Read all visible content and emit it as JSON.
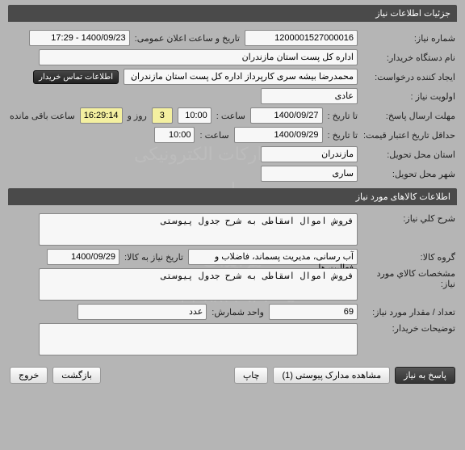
{
  "watermark": {
    "line1": "سامانه تدارکات الکترونیکی دولت",
    "line2": "پایگاه اطلاع رسانی مناقصات و مزایدات",
    "line3": "۰۲۱-۸۸۳۴۹۶۷۰-۵"
  },
  "need": {
    "header": "جزئیات اطلاعات نیاز",
    "number_label": "شماره نیاز:",
    "number": "1200001527000016",
    "announce_label": "تاریخ و ساعت اعلان عمومی:",
    "announce": "1400/09/23 - 17:29",
    "buyer_label": "نام دستگاه خریدار:",
    "buyer": "اداره کل پست استان مازندران",
    "requester_label": "ایجاد کننده درخواست:",
    "requester": "محمدرضا بیشه سری کارپرداز اداره کل پست استان مازندران",
    "contact_btn": "اطلاعات تماس خریدار",
    "priority_label": "اولویت نیاز :",
    "priority": "عادی",
    "deadline_label": "مهلت ارسال پاسخ:",
    "to_date_lbl": "تا تاریخ :",
    "deadline_date": "1400/09/27",
    "time_lbl": "ساعت :",
    "deadline_time": "10:00",
    "remain_days": "3",
    "days_lbl": "روز و",
    "remain_time": "16:29:14",
    "remain_lbl": "ساعت باقی مانده",
    "validity_label": "حداقل تاریخ اعتبار قیمت:",
    "validity_date": "1400/09/29",
    "validity_time": "10:00",
    "province_label": "استان محل تحویل:",
    "province": "مازندران",
    "city_label": "شهر محل تحویل:",
    "city": "ساری"
  },
  "goods": {
    "header": "اطلاعات کالاهای مورد نیاز",
    "general_label": "شرح کلي نیاز:",
    "general": "فروش اموال اسقاطی به شرح جدول پیوستی",
    "group_label": "گروه کالا:",
    "group": "آب رسانی، مدیریت پسماند، فاضلاب و فعالیت ها",
    "need_date_label": "تاریخ نیاز به کالا:",
    "need_date": "1400/09/29",
    "spec_label": "مشخصات کالاي مورد نیاز:",
    "spec": "فروش اموال اسقاطی به شرح جدول پیوستی",
    "qty_label": "تعداد / مقدار مورد نیاز:",
    "qty": "69",
    "unit_label": "واحد شمارش:",
    "unit": "عدد",
    "buyer_notes_label": "توضیحات خریدار:"
  },
  "buttons": {
    "respond": "پاسخ به نیاز",
    "attachments": "مشاهده مدارک پیوستی (1)",
    "print": "چاپ",
    "back": "بازگشت",
    "exit": "خروج"
  }
}
